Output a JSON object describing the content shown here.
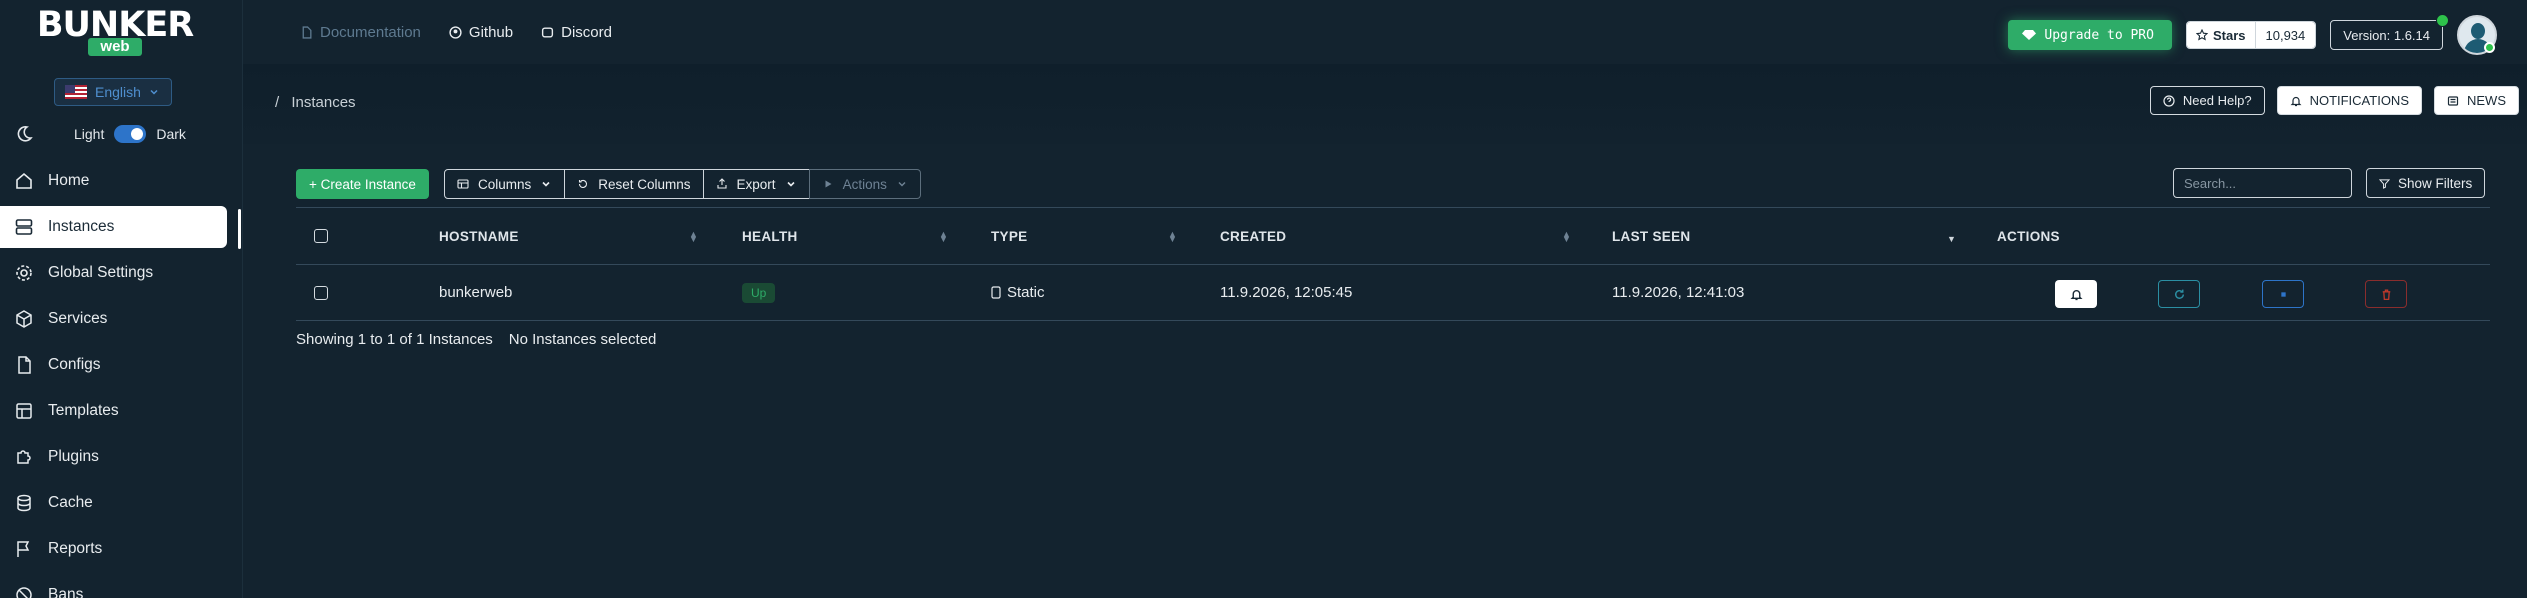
{
  "brand": {
    "word1": "BUNKER",
    "word2": "web"
  },
  "language": {
    "selected": "English"
  },
  "theme": {
    "light_label": "Light",
    "dark_label": "Dark"
  },
  "sidebar": {
    "items": [
      {
        "label": "Home",
        "icon": "home-icon"
      },
      {
        "label": "Instances",
        "icon": "server-icon",
        "active": true
      },
      {
        "label": "Global Settings",
        "icon": "gear-icon"
      },
      {
        "label": "Services",
        "icon": "box-icon"
      },
      {
        "label": "Configs",
        "icon": "file-icon"
      },
      {
        "label": "Templates",
        "icon": "layout-icon"
      },
      {
        "label": "Plugins",
        "icon": "puzzle-icon"
      },
      {
        "label": "Cache",
        "icon": "database-icon"
      },
      {
        "label": "Reports",
        "icon": "flag-icon"
      },
      {
        "label": "Bans",
        "icon": "ban-icon"
      }
    ]
  },
  "topbar": {
    "links": {
      "documentation": "Documentation",
      "github": "Github",
      "discord": "Discord"
    },
    "upgrade": "Upgrade to PRO",
    "stars_label": "Stars",
    "stars_count": "10,934",
    "version": "Version: 1.6.14"
  },
  "breadcrumb": {
    "separator": "/",
    "current": "Instances"
  },
  "header_buttons": {
    "help": "Need Help?",
    "notifications": "NOTIFICATIONS",
    "news": "NEWS"
  },
  "toolbar": {
    "create": "+ Create Instance",
    "columns": "Columns",
    "reset_columns": "Reset Columns",
    "export": "Export",
    "actions": "Actions",
    "search_placeholder": "Search...",
    "show_filters": "Show Filters"
  },
  "table": {
    "headers": {
      "hostname": "HOSTNAME",
      "health": "HEALTH",
      "type": "TYPE",
      "created": "CREATED",
      "last_seen": "LAST SEEN",
      "actions": "ACTIONS"
    },
    "rows": [
      {
        "hostname": "bunkerweb",
        "health": "Up",
        "type": "Static",
        "created": "11.9.2026, 12:05:45",
        "last_seen": "11.9.2026, 12:41:03"
      }
    ]
  },
  "footer": {
    "showing": "Showing 1 to 1 of 1 Instances",
    "selected": "No Instances selected"
  },
  "colors": {
    "background": "#13232f",
    "accent_green": "#2eac68",
    "active_toggle": "#2d74c9",
    "danger": "#c0392b",
    "info": "#2b8fa3"
  }
}
